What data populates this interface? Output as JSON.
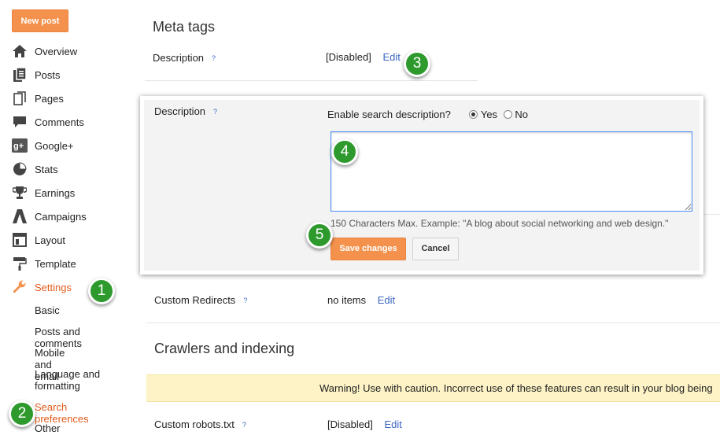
{
  "header": {
    "new_post_label": "New post"
  },
  "sidebar": {
    "items": [
      {
        "label": "Overview",
        "icon": "home-icon"
      },
      {
        "label": "Posts",
        "icon": "posts-icon"
      },
      {
        "label": "Pages",
        "icon": "pages-icon"
      },
      {
        "label": "Comments",
        "icon": "comment-icon"
      },
      {
        "label": "Google+",
        "icon": "google-plus-icon"
      },
      {
        "label": "Stats",
        "icon": "pie-chart-icon"
      },
      {
        "label": "Earnings",
        "icon": "trophy-icon"
      },
      {
        "label": "Campaigns",
        "icon": "campaigns-icon"
      },
      {
        "label": "Layout",
        "icon": "layout-icon"
      },
      {
        "label": "Template",
        "icon": "paint-roller-icon"
      },
      {
        "label": "Settings",
        "icon": "wrench-icon"
      }
    ],
    "sub_items": [
      "Basic",
      "Posts and comments",
      "Mobile and email",
      "Language and formatting",
      "Search preferences",
      "Other"
    ]
  },
  "main": {
    "meta_title": "Meta tags",
    "description_label": "Description",
    "help_mark": "?",
    "description_value": "[Disabled]",
    "edit_label": "Edit",
    "panel": {
      "label": "Description",
      "enable_question": "Enable search description?",
      "yes_label": "Yes",
      "no_label": "No",
      "hint": "150 Characters Max. Example: \"A blog about social networking and web design.\"",
      "save_label": "Save changes",
      "cancel_label": "Cancel"
    },
    "custom_redirects_label": "Custom Redirects",
    "custom_redirects_value": "no items",
    "crawlers_title": "Crawlers and indexing",
    "warning_text": "Warning! Use with caution. Incorrect use of these features can result in your blog being",
    "robots_label": "Custom robots.txt",
    "robots_value": "[Disabled]"
  },
  "callouts": [
    "1",
    "2",
    "3",
    "4",
    "5"
  ],
  "colors": {
    "accent": "#f4914c",
    "active_text": "#e25c1b",
    "link": "#3a66c2",
    "badge": "#2e9a2e",
    "warning_bg": "#fdf3c6"
  }
}
